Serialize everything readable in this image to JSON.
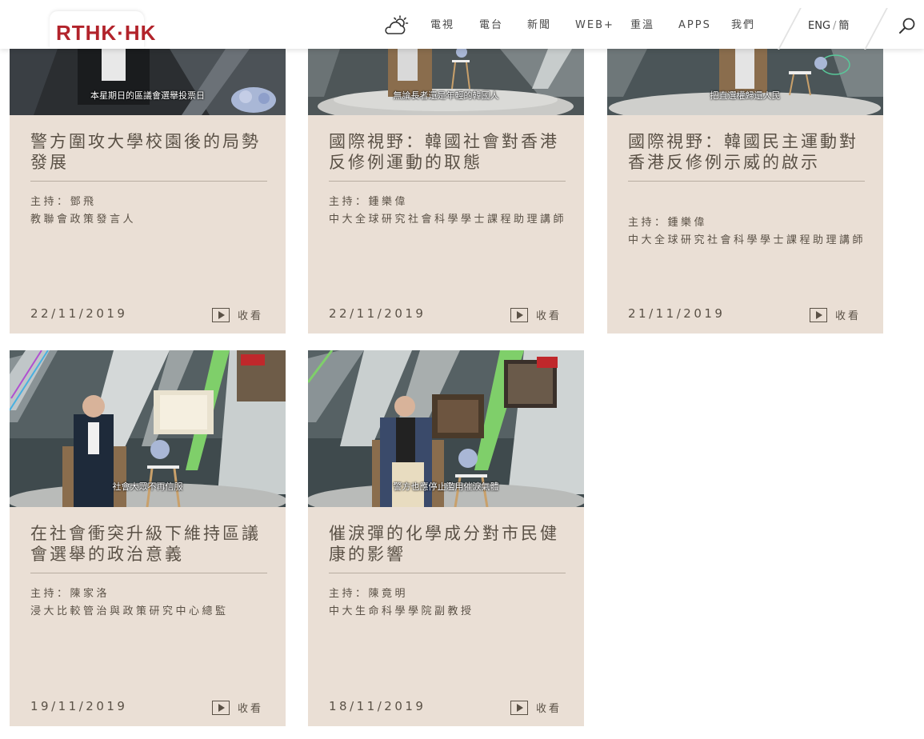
{
  "header": {
    "logo": "RTHK·HK",
    "nav": [
      "電視",
      "電台",
      "新聞",
      "WEB+",
      "重溫",
      "APPS",
      "我們"
    ],
    "lang_eng": "ENG",
    "lang_sep": "/",
    "lang_simplified": "簡"
  },
  "cards": [
    {
      "caption": "本星期日的區議會選舉投票日",
      "title": "警方圍攻大學校園後的局勢發展",
      "host_line1": "主持：鄧飛",
      "host_line2": "教聯會政策發言人",
      "date": "22/11/2019",
      "watch": "收看"
    },
    {
      "caption": "無論長者還是年輕的韓國人",
      "title": "國際視野：韓國社會對香港反修例運動的取態",
      "host_line1": "主持：鍾樂偉",
      "host_line2": "中大全球研究社會科學學士課程助理講師",
      "date": "22/11/2019",
      "watch": "收看"
    },
    {
      "caption": "把直選權歸還人民",
      "title": "國際視野：韓國民主運動對香港反修例示威的啟示",
      "host_line1": "主持：鍾樂偉",
      "host_line2": "中大全球研究社會科學學士課程助理講師",
      "date": "21/11/2019",
      "watch": "收看"
    },
    {
      "caption": "社會大眾不再信服",
      "title": "在社會衝突升級下維持區議會選舉的政治意義",
      "host_line1": "主持：陳家洛",
      "host_line2": "浸大比較管治與政策研究中心總監",
      "date": "19/11/2019",
      "watch": "收看"
    },
    {
      "caption": "警方也應停止濫用催淚氣體",
      "title": "催淚彈的化學成分對市民健康的影響",
      "host_line1": "主持：陳竟明",
      "host_line2": "中大生命科學學院副教授",
      "date": "18/11/2019",
      "watch": "收看"
    }
  ],
  "colors": {
    "brand_red": "#b2232b",
    "card_bg": "#eadfd5",
    "text": "#5a5146"
  }
}
